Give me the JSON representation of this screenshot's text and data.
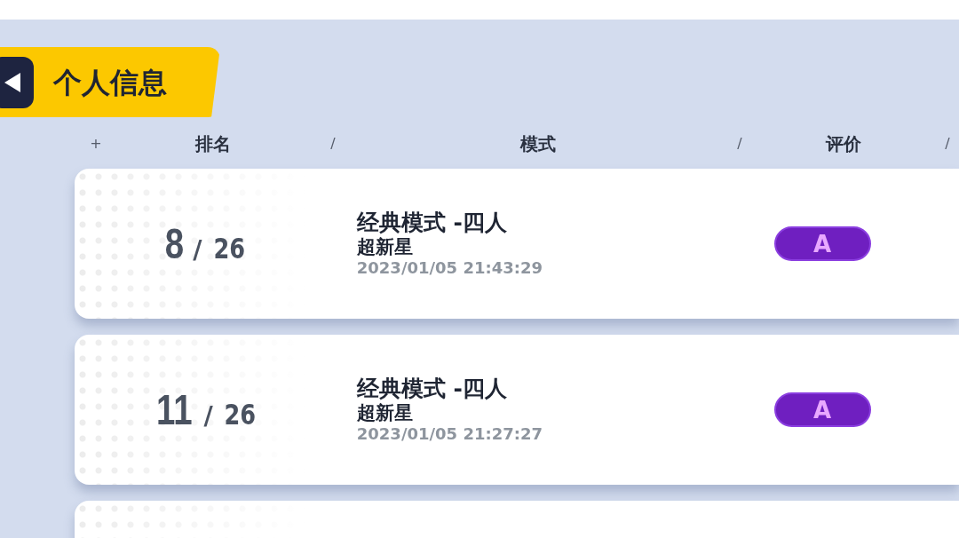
{
  "header": {
    "title": "个人信息"
  },
  "columns": [
    {
      "kind": "mark",
      "text": "+"
    },
    {
      "kind": "label",
      "text": "排名"
    },
    {
      "kind": "mark",
      "text": "/"
    },
    {
      "kind": "label",
      "text": "模式"
    },
    {
      "kind": "mark",
      "text": "/"
    },
    {
      "kind": "label",
      "text": "评价"
    },
    {
      "kind": "mark",
      "text": "/"
    }
  ],
  "rows": [
    {
      "rank": "8",
      "separator": "/",
      "total": "26",
      "mode": "经典模式 -四人",
      "tier": "超新星",
      "time": "2023/01/05 21:43:29",
      "grade": "A"
    },
    {
      "rank": "11",
      "separator": "/",
      "total": "26",
      "mode": "经典模式 -四人",
      "tier": "超新星",
      "time": "2023/01/05 21:27:27",
      "grade": "A"
    }
  ]
}
